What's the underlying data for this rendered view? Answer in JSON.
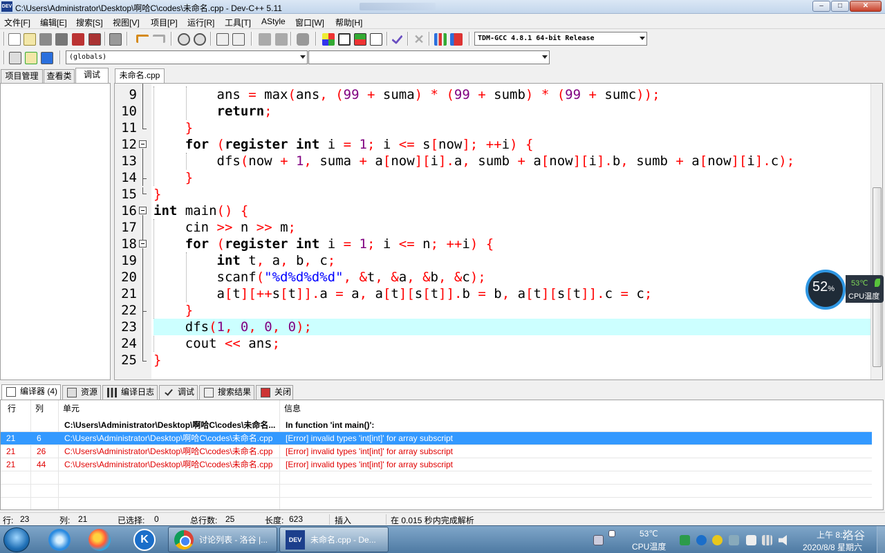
{
  "window": {
    "title": "C:\\Users\\Administrator\\Desktop\\啊哈C\\codes\\未命名.cpp - Dev-C++ 5.11",
    "app_icon_label": "DEV",
    "controls": {
      "minimize": "–",
      "maximize": "□",
      "close": "✕"
    }
  },
  "menu": [
    "文件[F]",
    "编辑[E]",
    "搜索[S]",
    "视图[V]",
    "项目[P]",
    "运行[R]",
    "工具[T]",
    "AStyle",
    "窗口[W]",
    "帮助[H]"
  ],
  "toolbar": {
    "compiler_select": "TDM-GCC 4.8.1 64-bit Release",
    "scope_select": "(globals)",
    "function_select": ""
  },
  "left_panel": {
    "tabs": [
      "项目管理",
      "查看类",
      "调试"
    ],
    "active_tab": "调试"
  },
  "editor": {
    "file_tab": "未命名.cpp",
    "current_line": 23,
    "line_numbers": [
      "9",
      "10",
      "11",
      "12",
      "13",
      "14",
      "15",
      "16",
      "17",
      "18",
      "19",
      "20",
      "21",
      "22",
      "23",
      "24",
      "25"
    ],
    "source_lines": [
      "        ans = max(ans, (99 + suma) * (99 + sumb) * (99 + sumc));",
      "        return;",
      "    }",
      "    for (register int i = 1; i <= s[now]; ++i) {",
      "        dfs(now + 1, suma + a[now][i].a, sumb + a[now][i].b, sumb + a[now][i].c);",
      "    }",
      "}",
      "int main() {",
      "    cin >> n >> m;",
      "    for (register int i = 1; i <= n; ++i) {",
      "        int t, a, b, c;",
      "        scanf(\"%d%d%d%d\", &t, &a, &b, &c);",
      "        a[t][++s[t]].a = a, a[t][s[t]].b = b, a[t][s[t]].c = c;",
      "    }",
      "    dfs(1, 0, 0, 0);",
      "    cout << ans;",
      "}"
    ]
  },
  "cpu_widget": {
    "percent": "52",
    "percent_sign": "%",
    "temperature": "53℃",
    "label": "CPU温度"
  },
  "bottom_tabs": [
    "编译器 (4)",
    "资源",
    "编译日志",
    "调试",
    "搜索结果",
    "关闭"
  ],
  "messages": {
    "columns": [
      "行",
      "列",
      "单元",
      "信息"
    ],
    "rows": [
      {
        "line": "",
        "col": "",
        "unit": "C:\\Users\\Administrator\\Desktop\\啊哈C\\codes\\未命名...",
        "message": "In function 'int main()':"
      },
      {
        "line": "21",
        "col": "6",
        "unit": "C:\\Users\\Administrator\\Desktop\\啊哈C\\codes\\未命名.cpp",
        "message": "[Error] invalid types 'int[int]' for array subscript"
      },
      {
        "line": "21",
        "col": "26",
        "unit": "C:\\Users\\Administrator\\Desktop\\啊哈C\\codes\\未命名.cpp",
        "message": "[Error] invalid types 'int[int]' for array subscript"
      },
      {
        "line": "21",
        "col": "44",
        "unit": "C:\\Users\\Administrator\\Desktop\\啊哈C\\codes\\未命名.cpp",
        "message": "[Error] invalid types 'int[int]' for array subscript"
      }
    ]
  },
  "status": {
    "line_label": "行:",
    "line_value": "23",
    "col_label": "列:",
    "col_value": "21",
    "selected_label": "已选择:",
    "selected_value": "0",
    "total_label": "总行数:",
    "total_value": "25",
    "length_label": "长度:",
    "length_value": "623",
    "mode": "插入",
    "parse_time": "在 0.015 秒内完成解析"
  },
  "taskbar": {
    "tasks": [
      {
        "label": "讨论列表 - 洛谷 |...",
        "icon": "chrome-icon"
      },
      {
        "label": "未命名.cpp - De...",
        "icon": "devcpp-icon"
      }
    ],
    "pinned_k_label": "K",
    "tray_temperature": "53℃",
    "tray_temperature_label": "CPU温度",
    "clock_time": "上午 8:2",
    "clock_date": "2020/8/8 星期六",
    "watermark": "洛谷"
  },
  "colors": {
    "keyword": "#000000",
    "symbol": "#ff0000",
    "number": "#800080",
    "string": "#0000ff",
    "current_line_bg": "#ccffff",
    "selected_row_bg": "#3399ff",
    "error_text": "#e00000"
  }
}
